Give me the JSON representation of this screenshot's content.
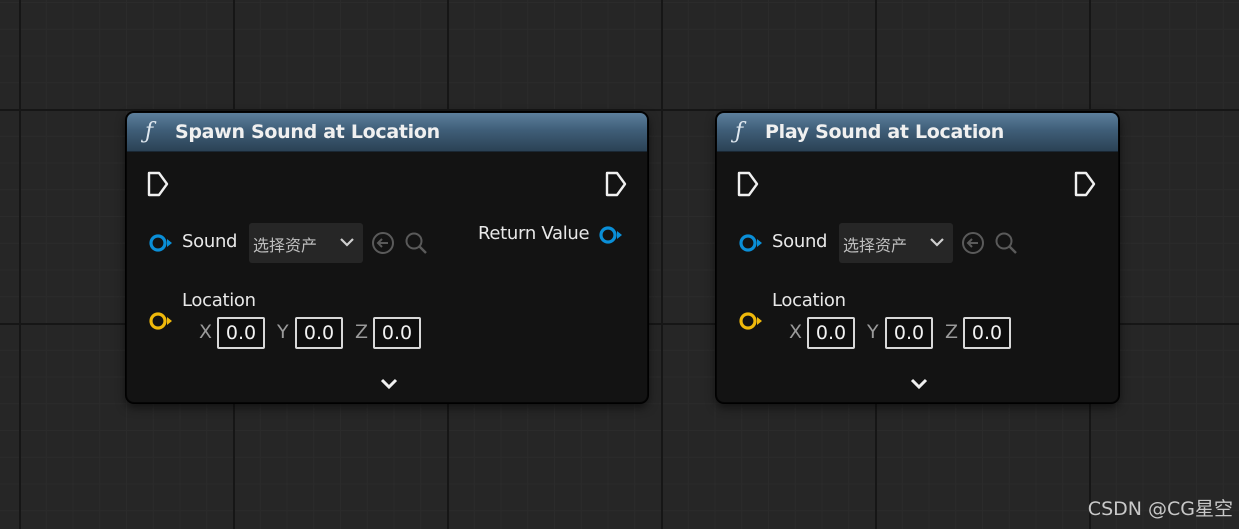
{
  "nodes": [
    {
      "title": "Spawn Sound at Location",
      "function_icon": "ƒ",
      "sound_label": "Sound",
      "asset_picker_text": "选择资产",
      "return_label": "Return Value",
      "location_label": "Location",
      "axes": {
        "x": "X",
        "y": "Y",
        "z": "Z"
      },
      "values": {
        "x": "0.0",
        "y": "0.0",
        "z": "0.0"
      }
    },
    {
      "title": "Play Sound at Location",
      "function_icon": "ƒ",
      "sound_label": "Sound",
      "asset_picker_text": "选择资产",
      "location_label": "Location",
      "axes": {
        "x": "X",
        "y": "Y",
        "z": "Z"
      },
      "values": {
        "x": "0.0",
        "y": "0.0",
        "z": "0.0"
      }
    }
  ],
  "icons": {
    "exec_pin": "exec-arrow-icon",
    "object_pin": "blue-object-pin-icon",
    "vector_pin": "yellow-vector-pin-icon",
    "browse": "back-arrow-circle-icon",
    "search": "search-icon",
    "dropdown": "chevron-down-icon",
    "expand": "chevron-down-icon"
  },
  "colors": {
    "header_blue": "#3f5e78",
    "object_pin": "#0a8fd8",
    "vector_pin": "#f0b90b",
    "node_body": "#131313"
  },
  "watermark": "CSDN @CG星空"
}
